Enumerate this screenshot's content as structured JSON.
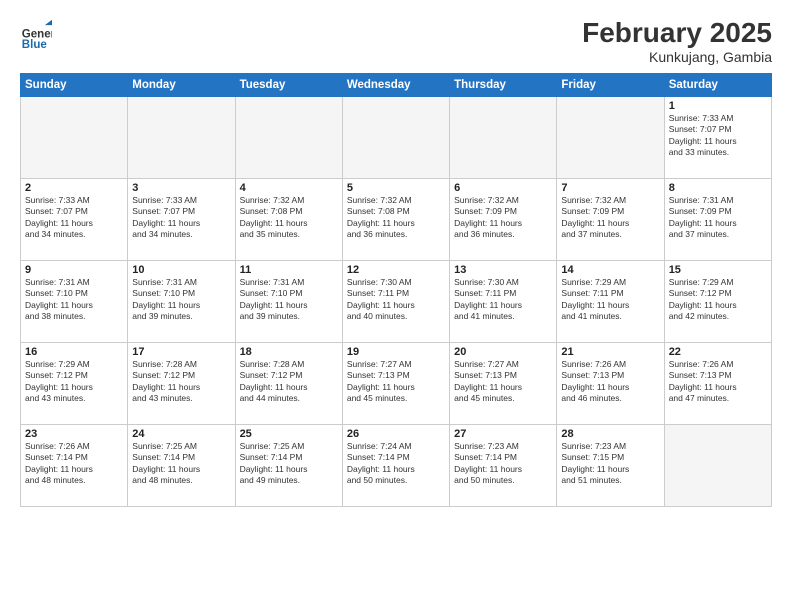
{
  "logo": {
    "general": "General",
    "blue": "Blue"
  },
  "title": "February 2025",
  "subtitle": "Kunkujang, Gambia",
  "days": [
    "Sunday",
    "Monday",
    "Tuesday",
    "Wednesday",
    "Thursday",
    "Friday",
    "Saturday"
  ],
  "weeks": [
    [
      {
        "day": "",
        "text": ""
      },
      {
        "day": "",
        "text": ""
      },
      {
        "day": "",
        "text": ""
      },
      {
        "day": "",
        "text": ""
      },
      {
        "day": "",
        "text": ""
      },
      {
        "day": "",
        "text": ""
      },
      {
        "day": "1",
        "text": "Sunrise: 7:33 AM\nSunset: 7:07 PM\nDaylight: 11 hours\nand 33 minutes."
      }
    ],
    [
      {
        "day": "2",
        "text": "Sunrise: 7:33 AM\nSunset: 7:07 PM\nDaylight: 11 hours\nand 34 minutes."
      },
      {
        "day": "3",
        "text": "Sunrise: 7:33 AM\nSunset: 7:07 PM\nDaylight: 11 hours\nand 34 minutes."
      },
      {
        "day": "4",
        "text": "Sunrise: 7:32 AM\nSunset: 7:08 PM\nDaylight: 11 hours\nand 35 minutes."
      },
      {
        "day": "5",
        "text": "Sunrise: 7:32 AM\nSunset: 7:08 PM\nDaylight: 11 hours\nand 36 minutes."
      },
      {
        "day": "6",
        "text": "Sunrise: 7:32 AM\nSunset: 7:09 PM\nDaylight: 11 hours\nand 36 minutes."
      },
      {
        "day": "7",
        "text": "Sunrise: 7:32 AM\nSunset: 7:09 PM\nDaylight: 11 hours\nand 37 minutes."
      },
      {
        "day": "8",
        "text": "Sunrise: 7:31 AM\nSunset: 7:09 PM\nDaylight: 11 hours\nand 37 minutes."
      }
    ],
    [
      {
        "day": "9",
        "text": "Sunrise: 7:31 AM\nSunset: 7:10 PM\nDaylight: 11 hours\nand 38 minutes."
      },
      {
        "day": "10",
        "text": "Sunrise: 7:31 AM\nSunset: 7:10 PM\nDaylight: 11 hours\nand 39 minutes."
      },
      {
        "day": "11",
        "text": "Sunrise: 7:31 AM\nSunset: 7:10 PM\nDaylight: 11 hours\nand 39 minutes."
      },
      {
        "day": "12",
        "text": "Sunrise: 7:30 AM\nSunset: 7:11 PM\nDaylight: 11 hours\nand 40 minutes."
      },
      {
        "day": "13",
        "text": "Sunrise: 7:30 AM\nSunset: 7:11 PM\nDaylight: 11 hours\nand 41 minutes."
      },
      {
        "day": "14",
        "text": "Sunrise: 7:29 AM\nSunset: 7:11 PM\nDaylight: 11 hours\nand 41 minutes."
      },
      {
        "day": "15",
        "text": "Sunrise: 7:29 AM\nSunset: 7:12 PM\nDaylight: 11 hours\nand 42 minutes."
      }
    ],
    [
      {
        "day": "16",
        "text": "Sunrise: 7:29 AM\nSunset: 7:12 PM\nDaylight: 11 hours\nand 43 minutes."
      },
      {
        "day": "17",
        "text": "Sunrise: 7:28 AM\nSunset: 7:12 PM\nDaylight: 11 hours\nand 43 minutes."
      },
      {
        "day": "18",
        "text": "Sunrise: 7:28 AM\nSunset: 7:12 PM\nDaylight: 11 hours\nand 44 minutes."
      },
      {
        "day": "19",
        "text": "Sunrise: 7:27 AM\nSunset: 7:13 PM\nDaylight: 11 hours\nand 45 minutes."
      },
      {
        "day": "20",
        "text": "Sunrise: 7:27 AM\nSunset: 7:13 PM\nDaylight: 11 hours\nand 45 minutes."
      },
      {
        "day": "21",
        "text": "Sunrise: 7:26 AM\nSunset: 7:13 PM\nDaylight: 11 hours\nand 46 minutes."
      },
      {
        "day": "22",
        "text": "Sunrise: 7:26 AM\nSunset: 7:13 PM\nDaylight: 11 hours\nand 47 minutes."
      }
    ],
    [
      {
        "day": "23",
        "text": "Sunrise: 7:26 AM\nSunset: 7:14 PM\nDaylight: 11 hours\nand 48 minutes."
      },
      {
        "day": "24",
        "text": "Sunrise: 7:25 AM\nSunset: 7:14 PM\nDaylight: 11 hours\nand 48 minutes."
      },
      {
        "day": "25",
        "text": "Sunrise: 7:25 AM\nSunset: 7:14 PM\nDaylight: 11 hours\nand 49 minutes."
      },
      {
        "day": "26",
        "text": "Sunrise: 7:24 AM\nSunset: 7:14 PM\nDaylight: 11 hours\nand 50 minutes."
      },
      {
        "day": "27",
        "text": "Sunrise: 7:23 AM\nSunset: 7:14 PM\nDaylight: 11 hours\nand 50 minutes."
      },
      {
        "day": "28",
        "text": "Sunrise: 7:23 AM\nSunset: 7:15 PM\nDaylight: 11 hours\nand 51 minutes."
      },
      {
        "day": "",
        "text": ""
      }
    ]
  ]
}
